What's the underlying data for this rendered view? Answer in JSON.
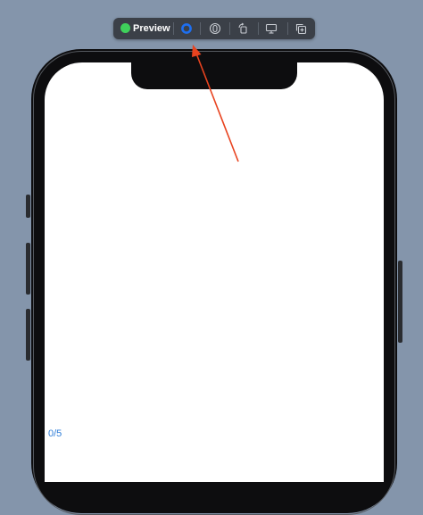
{
  "toolbar": {
    "status_label": "Preview",
    "status_color": "#3fd15b",
    "icons": [
      "live-preview-icon",
      "variant-icon",
      "rotate-device-icon",
      "device-settings-icon",
      "duplicate-preview-icon"
    ]
  },
  "screen": {
    "page_counter": "0/5"
  },
  "colors": {
    "background": "#8495ab",
    "toolbar_bg": "#3b4048",
    "accent_blue": "#1e6ff0",
    "counter_blue": "#2f7ed8",
    "annotation_arrow": "#e8431f"
  }
}
